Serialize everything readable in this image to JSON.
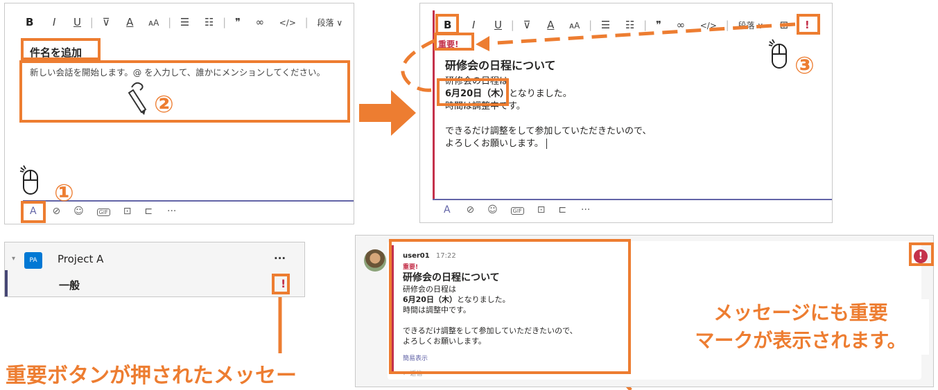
{
  "toolbar": {
    "bold": "B",
    "italic": "I",
    "underline": "U",
    "font_color": "A",
    "font_size": "ᴀA",
    "quote": "❞",
    "paragraph": "段落 ∨"
  },
  "compose": {
    "subject_placeholder": "件名を追加",
    "body_placeholder": "新しい会話を開始します。@ を入力して、誰かにメンションしてください。"
  },
  "bottom_toolbar": [
    "A",
    "⊘",
    "☺",
    "GIF",
    "⊡",
    "⊏",
    "···"
  ],
  "steps": [
    "①",
    "②",
    "③"
  ],
  "message_draft": {
    "important_label": "重要!",
    "subject": "研修会の日程について",
    "line1": "研修会の日程は",
    "date": "6月20日（木）",
    "line2_rest": "となりました。",
    "line3": "時間は調整中です。",
    "line4": "できるだけ調整をして参加していただきたいので、",
    "line5": "よろしくお願いします。"
  },
  "channel": {
    "badge": "PA",
    "team": "Project A",
    "name": "一般",
    "more": "···",
    "important_mark": "!"
  },
  "posted": {
    "author": "user01",
    "time": "17:22",
    "important_label": "重要!",
    "subject": "研修会の日程について",
    "line1": "研修会の日程は",
    "date": "6月20日（木）",
    "line2_rest": "となりました。",
    "line3": "時間は調整中です。",
    "line4": "できるだけ調整をして参加していただきたいので、",
    "line5": "よろしくお願いします。",
    "show_less": "簡易表示",
    "reply": "← 返信"
  },
  "callouts": {
    "left": "重要ボタンが押されたメッセー",
    "right_line1": "メッセージにも重要",
    "right_line2": "マークが表示されます。"
  },
  "colors": {
    "accent": "#ed7d31",
    "important": "#c4314b",
    "teams_blue": "#0078d4"
  }
}
